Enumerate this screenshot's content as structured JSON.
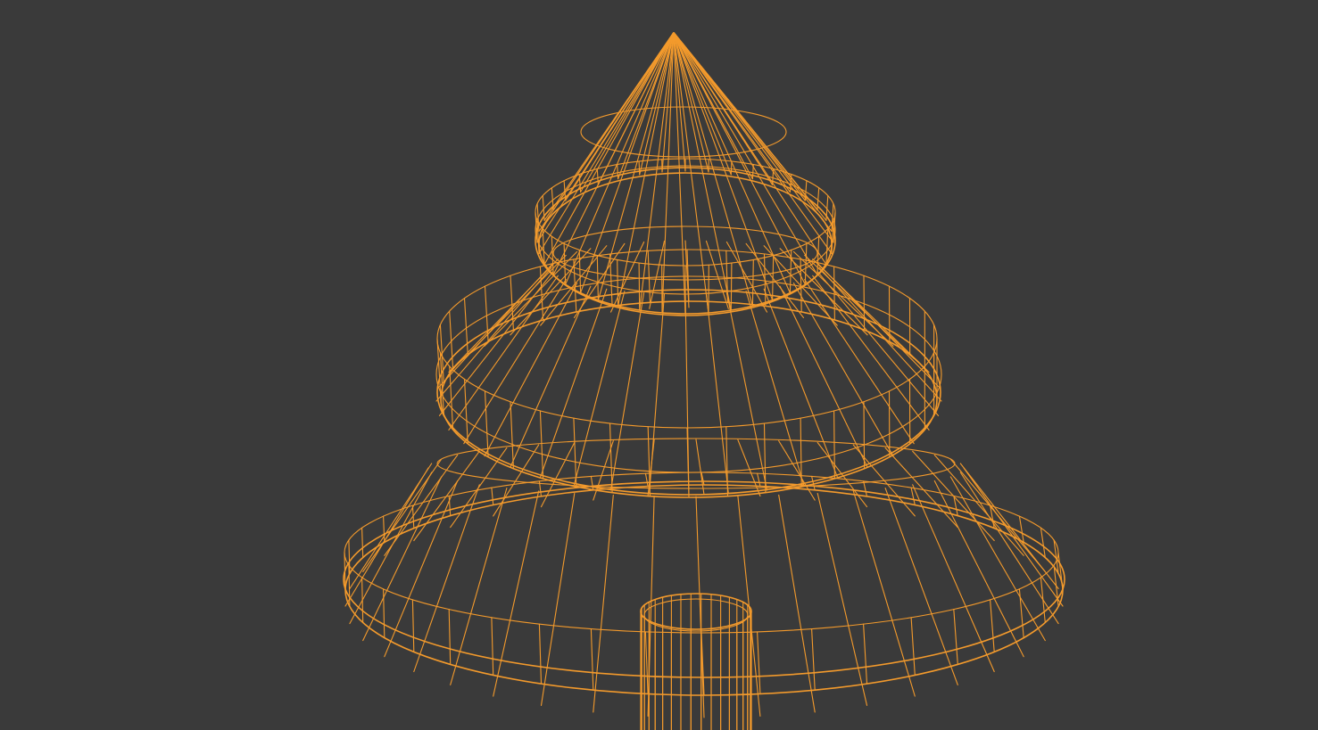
{
  "viewport": {
    "background_color": "#3a3a3a",
    "wireframe_color": "#f39a2c",
    "shading_mode": "wireframe",
    "selected_object": "tree"
  },
  "object": {
    "name": "tree",
    "parts": [
      {
        "name": "tree-tier-top",
        "type": "cone"
      },
      {
        "name": "tree-tier-middle",
        "type": "frustum"
      },
      {
        "name": "tree-tier-bottom",
        "type": "frustum"
      },
      {
        "name": "tree-trunk",
        "type": "cylinder"
      }
    ]
  }
}
